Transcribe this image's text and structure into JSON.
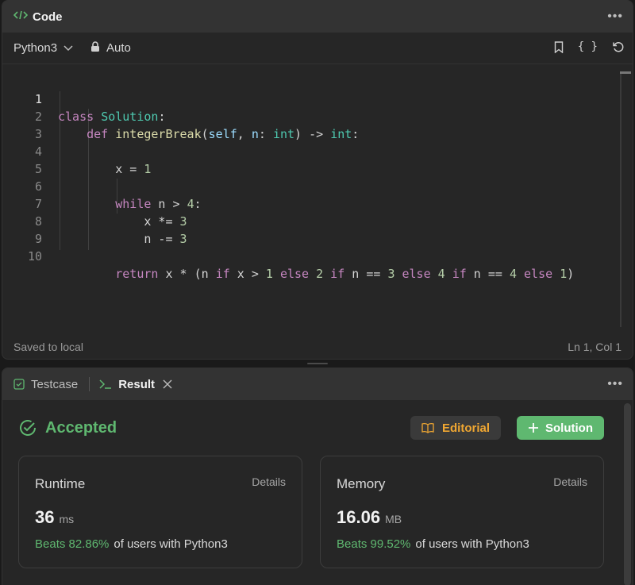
{
  "code_panel": {
    "title": "Code",
    "language": "Python3",
    "mode": "Auto",
    "status_left": "Saved to local",
    "status_right": "Ln 1, Col 1"
  },
  "code_lines": [
    "1",
    "2",
    "3",
    "4",
    "5",
    "6",
    "7",
    "8",
    "9",
    "10"
  ],
  "code": {
    "l1_kw": "class",
    "l1_cls": "Solution",
    "l1_colon": ":",
    "l2_kw": "def",
    "l2_fn": "integerBreak",
    "l2_p1": "(",
    "l2_self": "self",
    "l2_p2": ", ",
    "l2_n": "n",
    "l2_p3": ": ",
    "l2_int1": "int",
    "l2_p4": ") -> ",
    "l2_int2": "int",
    "l2_p5": ":",
    "l4_x": "x = ",
    "l4_num": "1",
    "l6_kw": "while",
    "l6_rest": " n > ",
    "l6_num": "4",
    "l6_colon": ":",
    "l7_x": "x *= ",
    "l7_num": "3",
    "l8_n": "n -= ",
    "l8_num": "3",
    "l10_kw1": "return",
    "l10_a": " x * (n ",
    "l10_kw2": "if",
    "l10_b": " x > ",
    "l10_n1": "1",
    "l10_kw3": " else ",
    "l10_n2": "2",
    "l10_kw4": " if",
    "l10_c": " n == ",
    "l10_n3": "3",
    "l10_kw5": " else ",
    "l10_n4": "4",
    "l10_kw6": " if",
    "l10_d": " n == ",
    "l10_n5": "4",
    "l10_kw7": " else ",
    "l10_n6": "1",
    "l10_e": ")"
  },
  "result_panel": {
    "tab_testcase": "Testcase",
    "tab_result": "Result",
    "status": "Accepted",
    "editorial_label": "Editorial",
    "solution_label": "Solution"
  },
  "runtime": {
    "title": "Runtime",
    "details": "Details",
    "value": "36",
    "unit": "ms",
    "beats": "Beats 82.86%",
    "beats_suffix": "of users with Python3"
  },
  "memory": {
    "title": "Memory",
    "details": "Details",
    "value": "16.06",
    "unit": "MB",
    "beats": "Beats 99.52%",
    "beats_suffix": "of users with Python3"
  },
  "colors": {
    "accent_green": "#5fb870",
    "accent_orange": "#f0a732",
    "panel_bg": "#262626",
    "header_bg": "#333333"
  }
}
